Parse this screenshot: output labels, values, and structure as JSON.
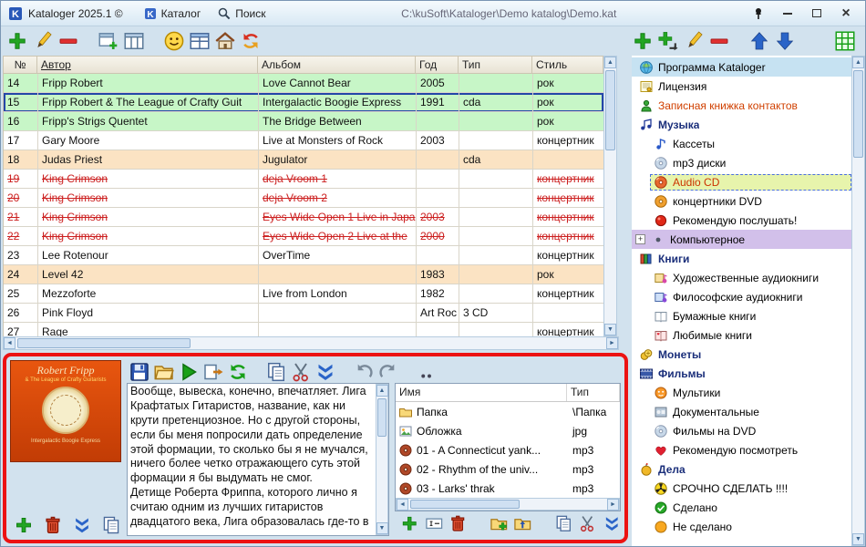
{
  "window": {
    "title": "Kataloger 2025.1 ©",
    "menu_catalog": "Каталог",
    "menu_search": "Поиск",
    "path": "C:\\kuSoft\\Kataloger\\Demo katalog\\Demo.kat"
  },
  "toolbars": {
    "main_left": [
      "add",
      "edit",
      "del",
      "gap",
      "add-child",
      "columns",
      "gap",
      "smiley",
      "table-view",
      "home",
      "refresh-red"
    ],
    "main_right": [
      "add",
      "add-sub",
      "edit",
      "del",
      "gap",
      "arrow-up",
      "arrow-down",
      "gap2",
      "grid-green"
    ],
    "cover": [
      "add",
      "trash",
      "chevrons-down",
      "copy"
    ],
    "editor": [
      "save",
      "open",
      "play",
      "export",
      "refresh-green",
      "gap",
      "copy",
      "cut",
      "chevrons-down",
      "gap",
      "undo",
      "redo",
      "gap",
      "more"
    ],
    "files": [
      "add",
      "rename",
      "trash",
      "gap",
      "folder-add",
      "folder-up",
      "gap",
      "copy",
      "cut",
      "chevrons-down"
    ]
  },
  "table": {
    "columns": [
      "№",
      "Автор",
      "Альбом",
      "Год",
      "Тип",
      "Стиль"
    ],
    "sorted_column": "Автор",
    "rows": [
      {
        "num": "14",
        "author": "Fripp Robert",
        "album": "Love Cannot Bear",
        "year": "2005",
        "type": "",
        "style": "рок",
        "variant": "green"
      },
      {
        "num": "15",
        "author": "Fripp Robert & The League of Crafty Guit",
        "album": "Intergalactic Boogie Express",
        "year": "1991",
        "type": "cda",
        "style": "рок",
        "variant": "selected"
      },
      {
        "num": "16",
        "author": "Fripp's Strigs Quentet",
        "album": "The Bridge Between",
        "year": "",
        "type": "",
        "style": "рок",
        "variant": "green"
      },
      {
        "num": "17",
        "author": "Gary Moore",
        "album": "Live at Monsters of Rock",
        "year": "2003",
        "type": "",
        "style": "концертник",
        "variant": "white"
      },
      {
        "num": "18",
        "author": "Judas Priest",
        "album": "Jugulator",
        "year": "",
        "type": "cda",
        "style": "",
        "variant": "peach"
      },
      {
        "num": "19",
        "author": "King Crimson",
        "album": "deja Vroom 1",
        "year": "",
        "type": "",
        "style": "концертник",
        "variant": "deleted"
      },
      {
        "num": "20",
        "author": "King Crimson",
        "album": "deja Vroom 2",
        "year": "",
        "type": "",
        "style": "концертник",
        "variant": "deleted"
      },
      {
        "num": "21",
        "author": "King Crimson",
        "album": "Eyes Wide Open 1 Live in Japa",
        "year": "2003",
        "type": "",
        "style": "концертник",
        "variant": "deleted"
      },
      {
        "num": "22",
        "author": "King Crimson",
        "album": "Eyes Wide Open 2 Live at the",
        "year": "2000",
        "type": "",
        "style": "концертник",
        "variant": "deleted"
      },
      {
        "num": "23",
        "author": "Lee Rotenour",
        "album": "OverTime",
        "year": "",
        "type": "",
        "style": "концертник",
        "variant": "white"
      },
      {
        "num": "24",
        "author": "Level 42",
        "album": "",
        "year": "1983",
        "type": "",
        "style": "рок",
        "variant": "peach"
      },
      {
        "num": "25",
        "author": "Mezzoforte",
        "album": "Live from London",
        "year": "1982",
        "type": "",
        "style": "концертник",
        "variant": "white"
      },
      {
        "num": "26",
        "author": "Pink Floyd",
        "album": "",
        "year": "Art Roc",
        "type": "3 CD",
        "style": "",
        "variant": "white"
      },
      {
        "num": "27",
        "author": "Rage",
        "album": "",
        "year": "",
        "type": "",
        "style": "концертник",
        "variant": "white"
      }
    ]
  },
  "tree": {
    "items": [
      {
        "label": "Программа Kataloger",
        "icon": "globe",
        "depth": 0,
        "bg": "#c6e2f2"
      },
      {
        "label": "Лицензия",
        "icon": "license",
        "depth": 0
      },
      {
        "label": "Записная книжка контактов",
        "icon": "contact",
        "depth": 0,
        "color": "#d04000"
      },
      {
        "label": "Музыка",
        "icon": "music",
        "depth": 0,
        "bold": true,
        "color": "#1a2e7a"
      },
      {
        "label": "Кассеты",
        "icon": "note",
        "depth": 1
      },
      {
        "label": "mp3 диски",
        "icon": "cd",
        "depth": 1
      },
      {
        "label": "Audio CD",
        "icon": "cd-red",
        "depth": 1,
        "selected": true,
        "color": "#cc3300"
      },
      {
        "label": "концертники DVD",
        "icon": "dvd",
        "depth": 1
      },
      {
        "label": "Рекомендую послушать!",
        "icon": "red-ball",
        "depth": 1
      },
      {
        "label": "Компьютерное",
        "icon": "dot",
        "depth": 0,
        "bg": "#d2c0ea",
        "marker": "+"
      },
      {
        "label": "Книги",
        "icon": "books",
        "depth": 0,
        "bold": true,
        "color": "#1a2e7a"
      },
      {
        "label": "Художественные аудиокниги",
        "icon": "audio-book",
        "depth": 1
      },
      {
        "label": "Философские аудиокниги",
        "icon": "audio-book2",
        "depth": 1
      },
      {
        "label": "Бумажные книги",
        "icon": "paper-book",
        "depth": 1
      },
      {
        "label": "Любимые книги",
        "icon": "fav-book",
        "depth": 1
      },
      {
        "label": "Монеты",
        "icon": "coins",
        "depth": 0,
        "bold": true,
        "color": "#1a2e7a"
      },
      {
        "label": "Фильмы",
        "icon": "films",
        "depth": 0,
        "bold": true,
        "color": "#1a2e7a"
      },
      {
        "label": "Мультики",
        "icon": "cartoon",
        "depth": 1
      },
      {
        "label": "Документальные",
        "icon": "doc-film",
        "depth": 1
      },
      {
        "label": "Фильмы на DVD",
        "icon": "cd",
        "depth": 1
      },
      {
        "label": "Рекомендую посмотреть",
        "icon": "heart",
        "depth": 1
      },
      {
        "label": "Дела",
        "icon": "tasks",
        "depth": 0,
        "bold": true,
        "color": "#1a2e7a"
      },
      {
        "label": "СРОЧНО СДЕЛАТЬ !!!!",
        "icon": "radiation",
        "depth": 1
      },
      {
        "label": "Сделано",
        "icon": "done",
        "depth": 1
      },
      {
        "label": "Не сделано",
        "icon": "notdone",
        "depth": 1
      }
    ]
  },
  "bottom": {
    "cover": {
      "artist": "Robert Fripp",
      "subtitle": "& The League of Crafty Guitarists",
      "caption": "Intergalactic Boogie Express"
    },
    "description": "Вообще, вывеска, конечно, впечатляет. Лига Крафтатых Гитаристов, название, как ни крути претенциозное. Но с другой стороны, если бы меня попросили дать определение этой формации, то сколько бы я не мучался, ничего более четко отражающего суть этой формации я бы выдумать не смог.\nДетище Роберта Фриппа, которого лично я считаю одним из лучших гитаристов двадцатого века, Лига образовалась где-то в",
    "files": {
      "columns": [
        "Имя",
        "Тип"
      ],
      "rows": [
        {
          "name": "Папка",
          "type": "\\Папка",
          "icon": "folder"
        },
        {
          "name": "Обложка",
          "type": "jpg",
          "icon": "image"
        },
        {
          "name": "01 - A Connecticut yank...",
          "type": "mp3",
          "icon": "cd-file"
        },
        {
          "name": "02 - Rhythm of the univ...",
          "type": "mp3",
          "icon": "cd-file"
        },
        {
          "name": "03 - Larks' thrak",
          "type": "mp3",
          "icon": "cd-file"
        }
      ]
    }
  }
}
